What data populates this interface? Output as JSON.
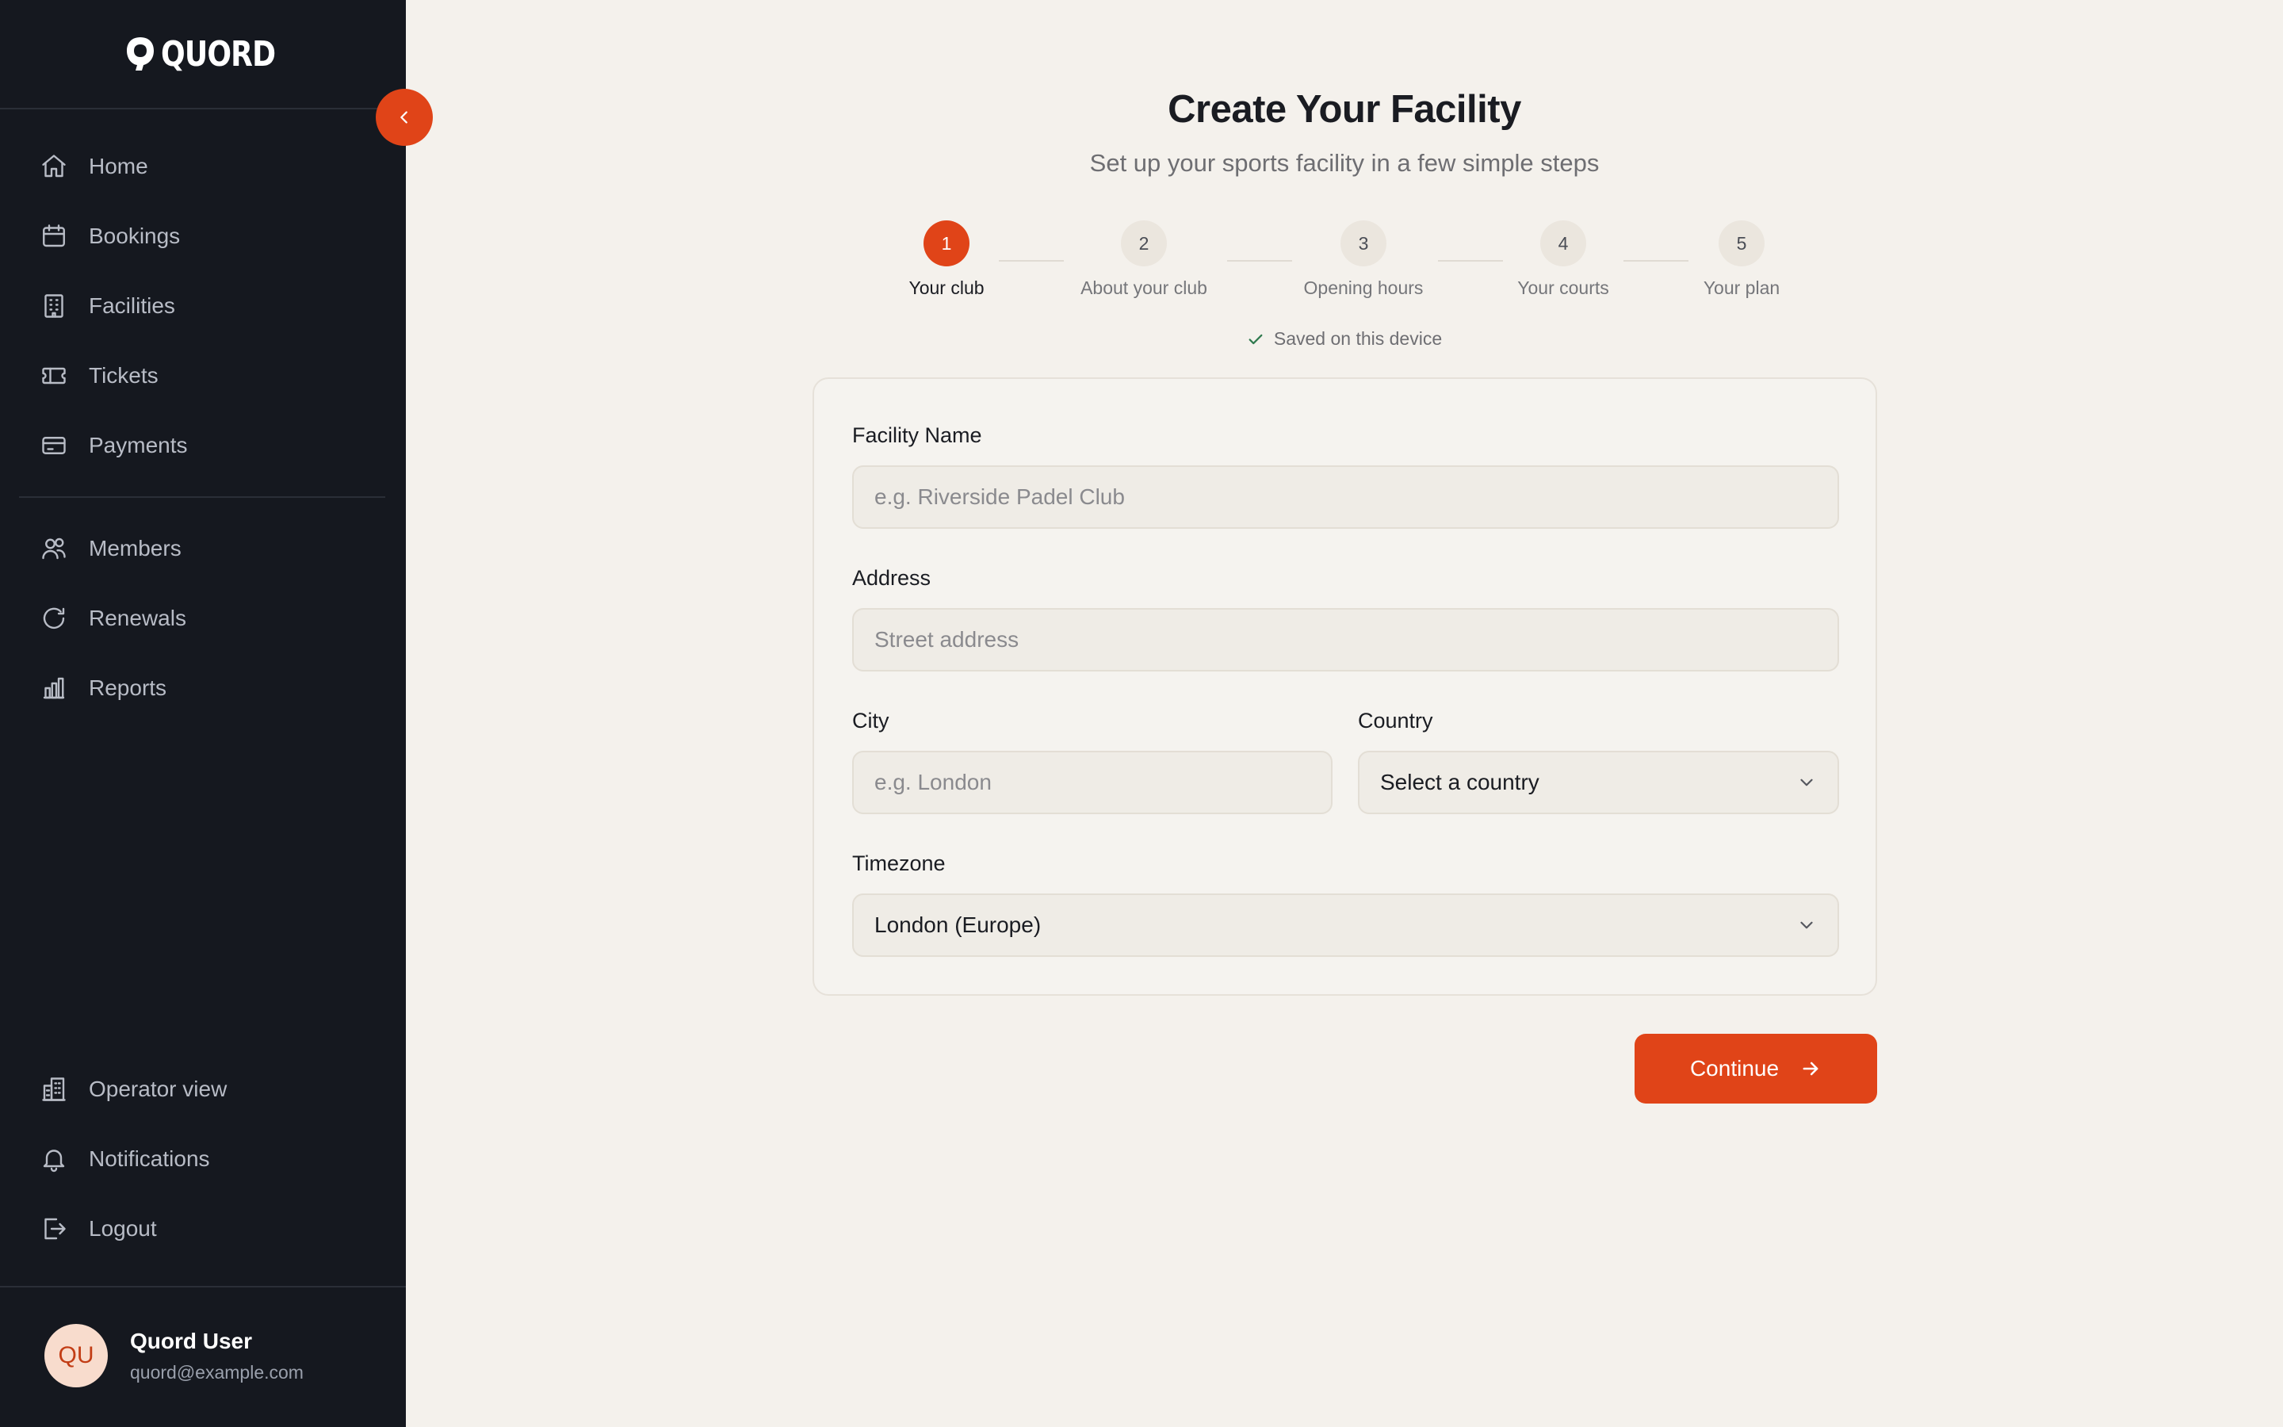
{
  "brand": {
    "name": "QUORD"
  },
  "sidebar": {
    "nav_main": [
      {
        "label": "Home",
        "icon": "home-icon"
      },
      {
        "label": "Bookings",
        "icon": "calendar-icon"
      },
      {
        "label": "Facilities",
        "icon": "building-icon"
      },
      {
        "label": "Tickets",
        "icon": "ticket-icon"
      },
      {
        "label": "Payments",
        "icon": "credit-card-icon"
      }
    ],
    "nav_secondary": [
      {
        "label": "Members",
        "icon": "users-icon"
      },
      {
        "label": "Renewals",
        "icon": "refresh-icon"
      },
      {
        "label": "Reports",
        "icon": "bar-chart-icon"
      }
    ],
    "nav_bottom": [
      {
        "label": "Operator view",
        "icon": "office-building-icon"
      },
      {
        "label": "Notifications",
        "icon": "bell-icon"
      },
      {
        "label": "Logout",
        "icon": "logout-icon"
      }
    ],
    "user": {
      "initials": "QU",
      "name": "Quord User",
      "email": "quord@example.com"
    }
  },
  "page": {
    "title": "Create Your Facility",
    "subtitle": "Set up your sports facility in a few simple steps",
    "saved_text": "Saved on this device"
  },
  "steps": [
    {
      "number": "1",
      "label": "Your club",
      "active": true
    },
    {
      "number": "2",
      "label": "About your club",
      "active": false
    },
    {
      "number": "3",
      "label": "Opening hours",
      "active": false
    },
    {
      "number": "4",
      "label": "Your courts",
      "active": false
    },
    {
      "number": "5",
      "label": "Your plan",
      "active": false
    }
  ],
  "form": {
    "facility_name": {
      "label": "Facility Name",
      "placeholder": "e.g. Riverside Padel Club",
      "value": ""
    },
    "address": {
      "label": "Address",
      "placeholder": "Street address",
      "value": ""
    },
    "city": {
      "label": "City",
      "placeholder": "e.g. London",
      "value": ""
    },
    "country": {
      "label": "Country",
      "value": "Select a country"
    },
    "timezone": {
      "label": "Timezone",
      "value": "London (Europe)"
    },
    "continue_label": "Continue"
  },
  "colors": {
    "accent": "#e04418",
    "sidebar_bg": "#15181f",
    "page_bg": "#f4f1ec"
  }
}
